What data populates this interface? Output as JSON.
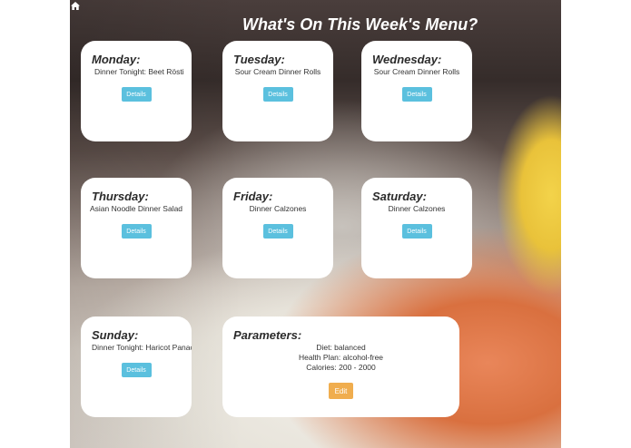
{
  "page": {
    "title": "What's On This Week's Menu?"
  },
  "icons": {
    "home": "home-icon"
  },
  "colors": {
    "details_button": "#5bc0de",
    "edit_button": "#f0ad4e",
    "card": "#ffffff"
  },
  "days": [
    {
      "day": "Monday:",
      "dish": "Dinner Tonight: Beet Rösti",
      "button": "Details"
    },
    {
      "day": "Tuesday:",
      "dish": "Sour Cream Dinner Rolls",
      "button": "Details"
    },
    {
      "day": "Wednesday:",
      "dish": "Sour Cream Dinner Rolls",
      "button": "Details"
    },
    {
      "day": "Thursday:",
      "dish": "Asian Noodle Dinner Salad",
      "button": "Details"
    },
    {
      "day": "Friday:",
      "dish": "Dinner Calzones",
      "button": "Details"
    },
    {
      "day": "Saturday:",
      "dish": "Dinner Calzones",
      "button": "Details"
    },
    {
      "day": "Sunday:",
      "dish": "Dinner Tonight: Haricot Panache",
      "button": "Details"
    }
  ],
  "parameters": {
    "heading": "Parameters:",
    "diet": "Diet: balanced",
    "health_plan": "Health Plan: alcohol-free",
    "calories": "Calories: 200 - 2000",
    "edit_label": "Edit"
  }
}
